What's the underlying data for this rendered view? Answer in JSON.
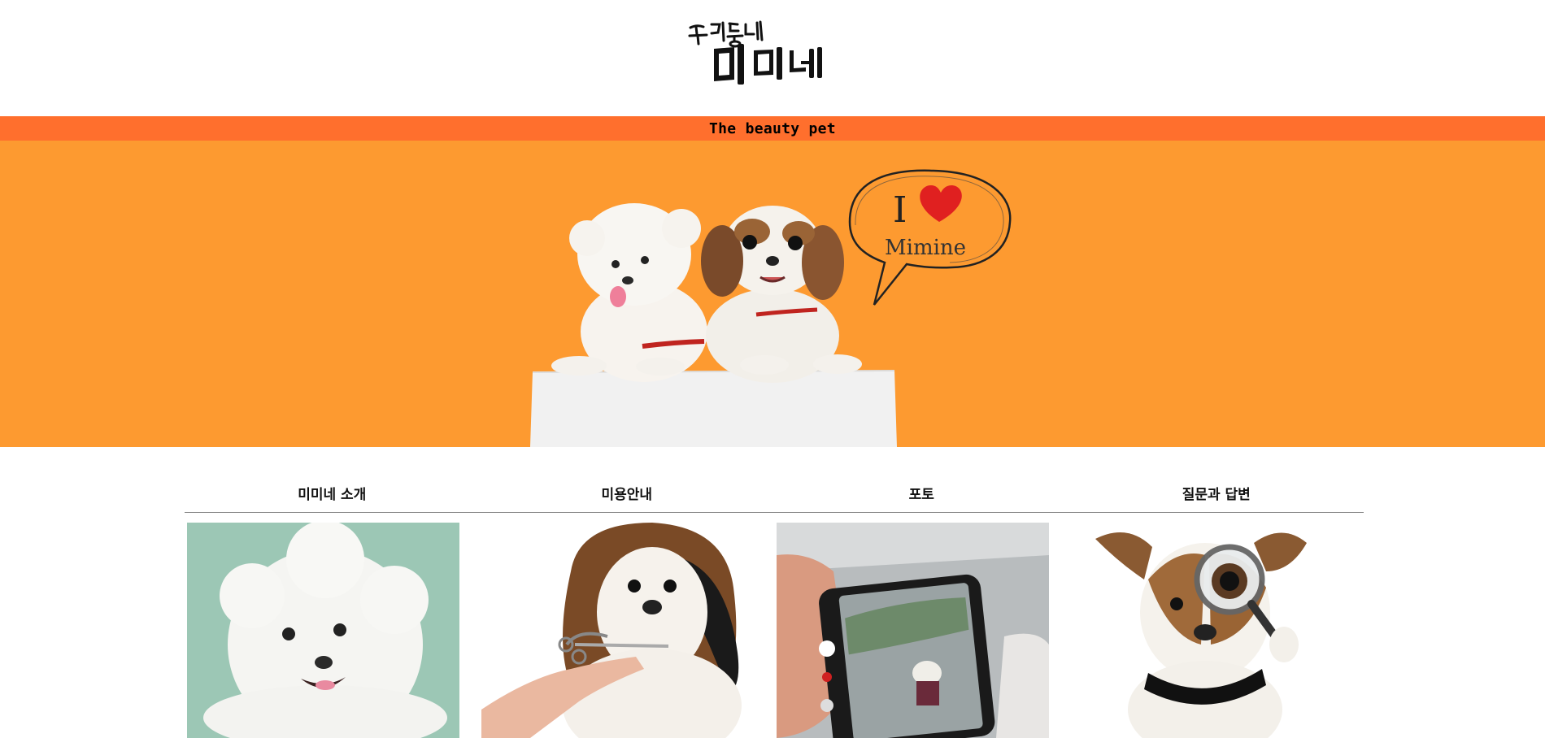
{
  "header": {
    "logo_icon": "mimine-handwritten-logo-icon",
    "logo_text": "우리동네 미미네"
  },
  "tagline": "The beauty pet",
  "hero": {
    "background_color": "#fd9a30",
    "speech_bubble_text": "Mimine",
    "heart_icon": "heart-icon",
    "image_desc_icon": "two-dogs-on-box-image"
  },
  "colors": {
    "tagline_bar": "#ff6f2d",
    "hero_bg": "#fd9a30",
    "nav_border": "#8a8a8a"
  },
  "nav": {
    "items": [
      {
        "label": "미미네 소개"
      },
      {
        "label": "미용안내"
      },
      {
        "label": "포토"
      },
      {
        "label": "질문과 답변"
      }
    ]
  },
  "cards": [
    {
      "icon": "bichon-photo"
    },
    {
      "icon": "shih-tzu-grooming-photo"
    },
    {
      "icon": "phone-photo-dog-photo"
    },
    {
      "icon": "jack-russell-magnifier-photo"
    }
  ]
}
